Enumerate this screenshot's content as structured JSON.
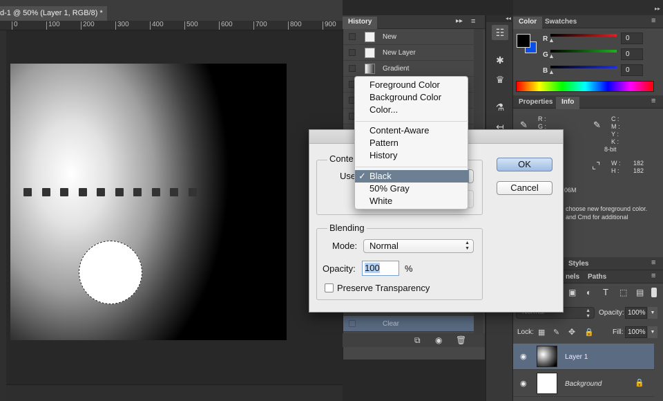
{
  "document_tab": {
    "title": "d-1 @ 50% (Layer 1, RGB/8) *"
  },
  "ruler": {
    "ticks": [
      "0",
      "100",
      "200",
      "300",
      "400",
      "500",
      "600",
      "700",
      "800",
      "900"
    ]
  },
  "history": {
    "tab": "History",
    "items": [
      {
        "label": "New",
        "icon": "document-icon"
      },
      {
        "label": "New Layer",
        "icon": "document-icon"
      },
      {
        "label": "Gradient",
        "icon": "gradient-icon"
      }
    ],
    "clear_label": "Clear"
  },
  "color_panel": {
    "tabs": [
      "Color",
      "Swatches"
    ],
    "channels": [
      {
        "label": "R",
        "value": "0",
        "color": "#e02020"
      },
      {
        "label": "G",
        "value": "0",
        "color": "#20b020"
      },
      {
        "label": "B",
        "value": "0",
        "color": "#2030e0"
      }
    ],
    "foreground": "#000000",
    "background": "#0a4fe8"
  },
  "info_panel": {
    "tabs": [
      "Properties",
      "Info"
    ],
    "rgb_labels": [
      "R :",
      "G :"
    ],
    "cmyk_labels": [
      "C :",
      "M :",
      "Y :",
      "K :"
    ],
    "bit_depth": "8-bit",
    "w_label": "W :",
    "w_value": "182",
    "h_label": "H :",
    "h_value": "182",
    "doc_size": "06M",
    "hint_line1": "choose new foreground color.",
    "hint_line2": "and Cmd for additional"
  },
  "layers_panel": {
    "tabs_top": [
      "Styles"
    ],
    "tabs": [
      "nels",
      "Paths"
    ],
    "blend_mode": "Normal",
    "opacity_label": "Opacity:",
    "opacity_value": "100%",
    "lock_label": "Lock:",
    "fill_label": "Fill:",
    "fill_value": "100%",
    "layers": [
      {
        "name": "Layer 1",
        "selected": true
      },
      {
        "name": "Background",
        "selected": false
      }
    ]
  },
  "dialog": {
    "contents_label": "Conte",
    "use_label": "Use",
    "blending_label": "Blending",
    "mode_label": "Mode:",
    "mode_value": "Normal",
    "opacity_label": "Opacity:",
    "opacity_value": "100",
    "opacity_unit": "%",
    "preserve_label": "Preserve Transparency",
    "ok_label": "OK",
    "cancel_label": "Cancel"
  },
  "use_menu": {
    "groups": [
      [
        "Foreground Color",
        "Background Color",
        "Color..."
      ],
      [
        "Content-Aware",
        "Pattern",
        "History"
      ],
      [
        "Black",
        "50% Gray",
        "White"
      ]
    ],
    "selected": "Black",
    "checkmark": "✓"
  }
}
